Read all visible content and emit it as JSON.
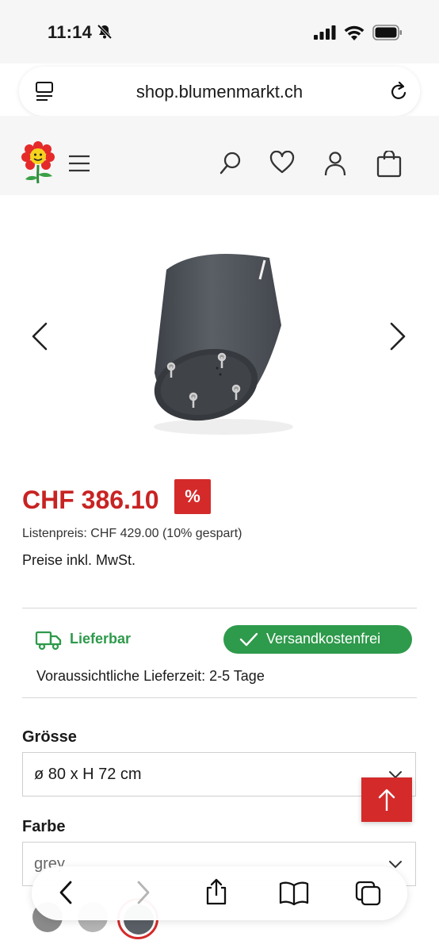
{
  "status_bar": {
    "time": "11:14",
    "icons": [
      "bell-slash-icon",
      "signal-icon",
      "wifi-icon",
      "battery-icon"
    ]
  },
  "browser": {
    "url": "shop.blumenmarkt.ch",
    "toolbar_icons": [
      "back-icon",
      "forward-icon",
      "share-icon",
      "bookmarks-icon",
      "tabs-icon"
    ]
  },
  "header": {
    "icons": [
      "flower-logo",
      "menu-icon",
      "search-icon",
      "heart-icon",
      "user-icon",
      "bag-icon"
    ]
  },
  "product": {
    "price": "CHF 386.10",
    "discount_badge": "%",
    "list_price": "Listenpreis: CHF 429.00 (10% gespart)",
    "vat_note": "Preise inkl. MwSt."
  },
  "delivery": {
    "availability": "Lieferbar",
    "shipping_badge": "Versandkostenfrei",
    "delivery_time": "Voraussichtliche Lieferzeit: 2-5 Tage"
  },
  "options": {
    "size_label": "Grösse",
    "size_value": "ø 80 x H 72 cm",
    "color_label": "Farbe",
    "color_value": "grey"
  },
  "colors": {
    "accent_red": "#d42a2a",
    "price_red": "#c82323",
    "success_green": "#2e9a4b"
  }
}
